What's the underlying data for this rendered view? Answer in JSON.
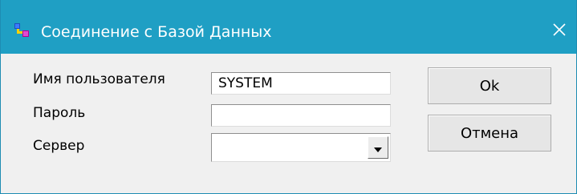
{
  "window": {
    "title": "Соединение с Базой Данных",
    "icon": "database-connection-icon",
    "close_icon": "close-icon",
    "titlebar_color": "#1f9fc4"
  },
  "form": {
    "username_label": "Имя пользователя",
    "username_value": "SYSTEM",
    "password_label": "Пароль",
    "password_value": "",
    "server_label": "Сервер",
    "server_value": ""
  },
  "buttons": {
    "ok_label": "Ok",
    "cancel_label": "Отмена"
  }
}
